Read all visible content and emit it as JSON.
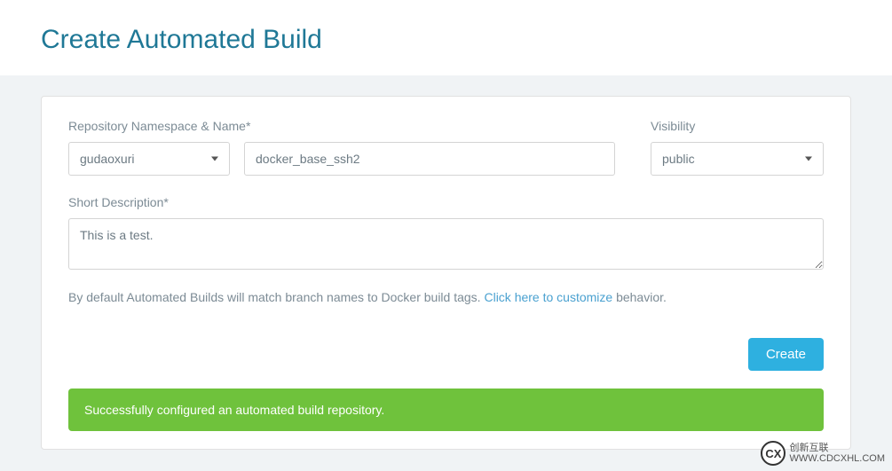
{
  "header": {
    "title": "Create Automated Build"
  },
  "form": {
    "namespace_label": "Repository Namespace & Name*",
    "namespace_value": "gudaoxuri",
    "name_value": "docker_base_ssh2",
    "visibility_label": "Visibility",
    "visibility_value": "public",
    "description_label": "Short Description*",
    "description_value": "This is a test.",
    "help_prefix": "By default Automated Builds will match branch names to Docker build tags. ",
    "help_link": "Click here to customize",
    "help_suffix": " behavior.",
    "create_button": "Create"
  },
  "alert": {
    "message": "Successfully configured an automated build repository."
  },
  "watermark": {
    "logo": "CX",
    "line1": "创新互联",
    "line2": "WWW.CDCXHL.COM"
  }
}
